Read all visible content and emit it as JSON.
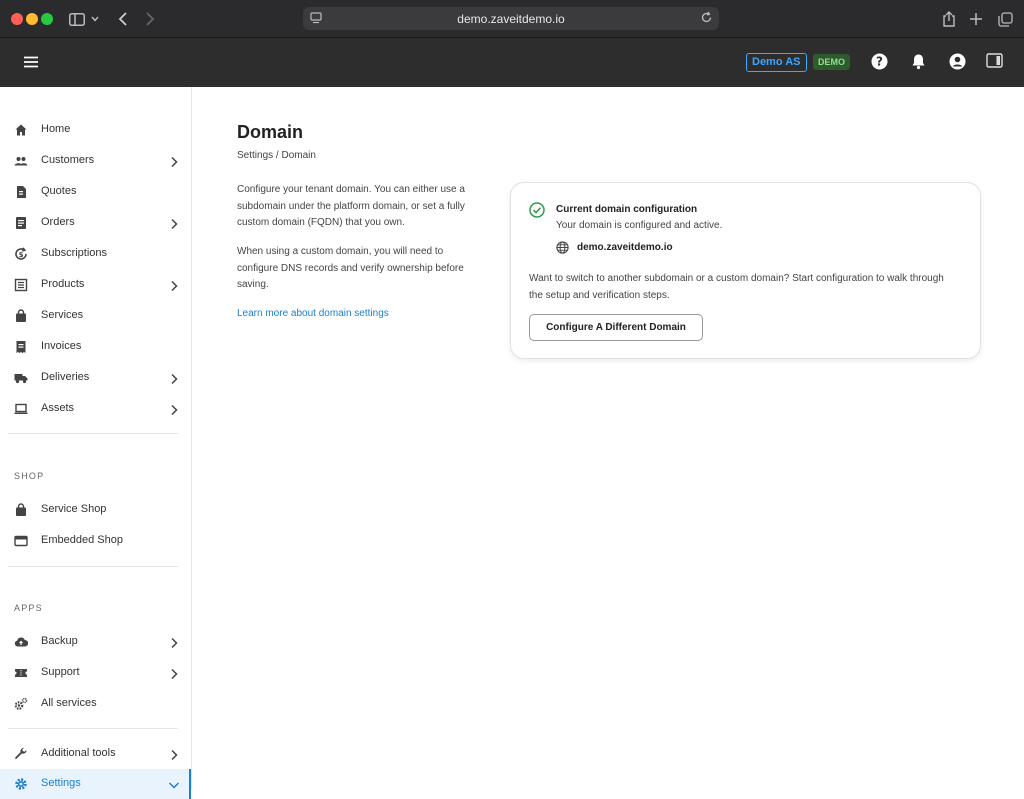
{
  "browser": {
    "url": "demo.zaveitdemo.io",
    "colors": {
      "close": "#ff5f57",
      "minimize": "#febc2e",
      "zoom": "#28c840"
    }
  },
  "appbar": {
    "tenant_label": "Demo AS",
    "env_badge": "DEMO",
    "accent": "#3da6ff"
  },
  "sidebar": {
    "items": [
      {
        "label": "Home",
        "icon": "home-icon",
        "has_children": false
      },
      {
        "label": "Customers",
        "icon": "people-icon",
        "has_children": true
      },
      {
        "label": "Quotes",
        "icon": "quote-doc-icon",
        "has_children": false
      },
      {
        "label": "Orders",
        "icon": "order-doc-icon",
        "has_children": true
      },
      {
        "label": "Subscriptions",
        "icon": "subscriptions-icon",
        "has_children": false
      },
      {
        "label": "Products",
        "icon": "products-icon",
        "has_children": true
      },
      {
        "label": "Services",
        "icon": "bag-icon",
        "has_children": false
      },
      {
        "label": "Invoices",
        "icon": "invoice-icon",
        "has_children": false
      },
      {
        "label": "Deliveries",
        "icon": "truck-icon",
        "has_children": true
      },
      {
        "label": "Assets",
        "icon": "laptop-icon",
        "has_children": true
      }
    ],
    "shop_title": "SHOP",
    "shop_items": [
      {
        "label": "Service Shop",
        "icon": "bag-icon"
      },
      {
        "label": "Embedded Shop",
        "icon": "embed-icon"
      }
    ],
    "apps_title": "APPS",
    "app_items": [
      {
        "label": "Backup",
        "icon": "cloud-upload-icon",
        "has_children": true
      },
      {
        "label": "Support",
        "icon": "ticket-icon",
        "has_children": true
      },
      {
        "label": "All services",
        "icon": "gears-icon",
        "has_children": false
      }
    ],
    "tool_items": [
      {
        "label": "Additional tools",
        "icon": "wrench-icon",
        "has_children": true
      },
      {
        "label": "Settings",
        "icon": "gear-icon",
        "has_children": true,
        "active": true
      }
    ]
  },
  "main": {
    "title": "Domain",
    "breadcrumb": "Settings / Domain",
    "description_1": "Configure your tenant domain. You can either use a subdomain under the platform domain, or set a fully custom domain (FQDN) that you own.",
    "description_2": "When using a custom domain, you will need to configure DNS records and verify ownership before saving.",
    "learn_link": "Learn more about domain settings",
    "card": {
      "title": "Current domain configuration",
      "status": "Your domain is configured and active.",
      "domain": "demo.zaveitdemo.io",
      "switch_text": "Want to switch to another subdomain or a custom domain? Start configuration to walk through the setup and verification steps.",
      "button_label": "Configure A Different Domain",
      "success_color": "#2e9e4f"
    }
  }
}
